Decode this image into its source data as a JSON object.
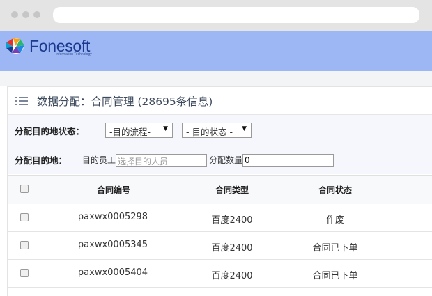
{
  "brand": {
    "name": "Fonesoft",
    "tagline": "Information Technology"
  },
  "page": {
    "title": "数据分配：合同管理 (28695条信息)"
  },
  "filters": {
    "status_label": "分配目的地状态：",
    "flow_select": "-目的流程-",
    "state_select": "- 目的状态 -",
    "dest_label": "分配目的地：",
    "employee_label": "目的员工",
    "employee_placeholder": "选择目的人员",
    "quantity_label": "分配数量",
    "quantity_value": "0"
  },
  "table": {
    "columns": [
      "合同编号",
      "合同类型",
      "合同状态"
    ],
    "rows": [
      {
        "id": "paxwx0005298",
        "type": "百度2400",
        "status": "作废"
      },
      {
        "id": "paxwx0005345",
        "type": "百度2400",
        "status": "合同已下单"
      },
      {
        "id": "paxwx0005404",
        "type": "百度2400",
        "status": "合同已下单"
      }
    ]
  },
  "icons": [
    "window-dot-icon",
    "logo-icon",
    "list-icon",
    "caret-down-icon",
    "checkbox-icon"
  ]
}
